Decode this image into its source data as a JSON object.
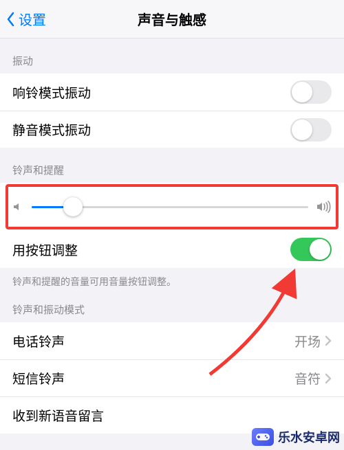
{
  "nav": {
    "back": "设置",
    "title": "声音与触感"
  },
  "vibration": {
    "header": "振动",
    "ring": {
      "label": "响铃模式振动",
      "on": false
    },
    "silent": {
      "label": "静音模式振动",
      "on": false
    }
  },
  "ringer": {
    "header": "铃声和提醒",
    "volume_percent": 15,
    "change_with_buttons": {
      "label": "用按钮调整",
      "on": true
    },
    "footer": "铃声和提醒的音量可用音量按钮调整。"
  },
  "patterns": {
    "header": "铃声和振动模式",
    "ringtone": {
      "label": "电话铃声",
      "value": "开场"
    },
    "texttone": {
      "label": "短信铃声",
      "value": "音符"
    },
    "voicemail": {
      "label": "收到新语音留言",
      "value": ""
    }
  },
  "annotation": {
    "highlight_color": "#f03a33"
  },
  "watermark": {
    "text": "乐水安卓网"
  }
}
